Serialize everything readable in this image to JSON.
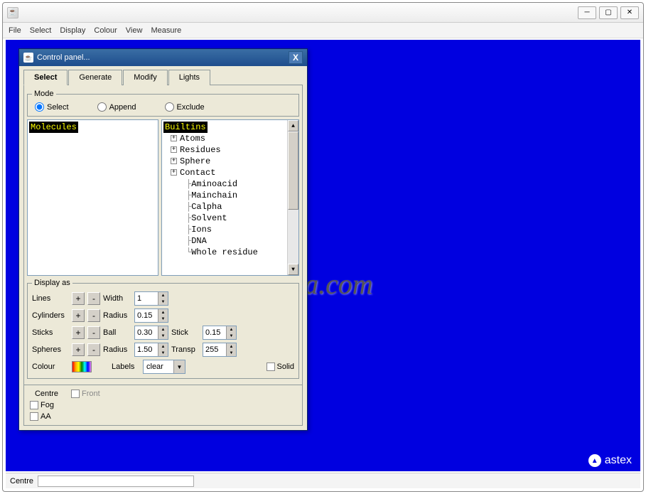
{
  "menu": {
    "file": "File",
    "select": "Select",
    "display": "Display",
    "colour": "Colour",
    "view": "View",
    "measure": "Measure"
  },
  "panel": {
    "title": "Control panel...",
    "tabs": {
      "select": "Select",
      "generate": "Generate",
      "modify": "Modify",
      "lights": "Lights"
    },
    "mode": {
      "legend": "Mode",
      "select": "Select",
      "append": "Append",
      "exclude": "Exclude"
    },
    "left_header": "Molecules",
    "right_header": "Builtins",
    "tree": {
      "atoms": "Atoms",
      "residues": "Residues",
      "sphere": "Sphere",
      "contact": "Contact",
      "aminoacid": "Aminoacid",
      "mainchain": "Mainchain",
      "calpha": "Calpha",
      "solvent": "Solvent",
      "ions": "Ions",
      "dna": "DNA",
      "wholeresidue": "Whole residue"
    },
    "display": {
      "legend": "Display as",
      "lines": "Lines",
      "width": "Width",
      "width_val": "1",
      "cylinders": "Cylinders",
      "radius": "Radius",
      "cyl_radius_val": "0.15",
      "sticks": "Sticks",
      "ball": "Ball",
      "ball_val": "0.30",
      "stick": "Stick",
      "stick_val": "0.15",
      "spheres": "Spheres",
      "sph_radius_val": "1.50",
      "transp": "Transp",
      "transp_val": "255",
      "colour": "Colour",
      "labels": "Labels",
      "labels_val": "clear",
      "solid": "Solid"
    },
    "bottom": {
      "centre": "Centre",
      "front": "Front",
      "fog": "Fog",
      "aa": "AA"
    }
  },
  "status": {
    "centre": "Centre"
  },
  "watermark": "SoftSea.com",
  "astex": "astex"
}
